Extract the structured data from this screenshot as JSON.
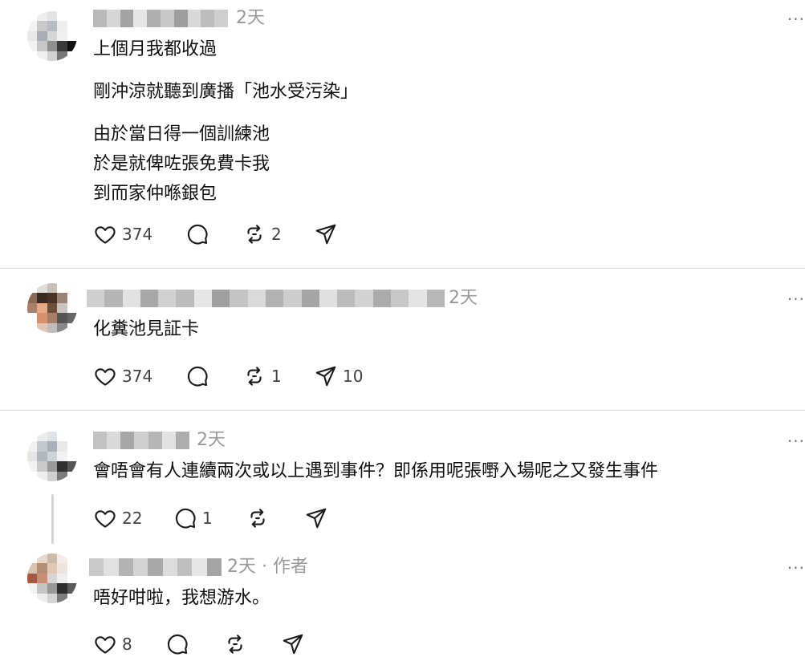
{
  "posts": [
    {
      "time": "2天",
      "lines": [
        "上個月我都收過",
        "剛沖涼就聽到廣播「池水受污染」",
        "由於當日得一個訓練池",
        "於是就俾咗張免費卡我",
        "到而家仲喺銀包"
      ],
      "likes": "374",
      "replies": "",
      "reposts": "2",
      "shares": ""
    },
    {
      "time": "2天",
      "lines": [
        "化糞池見証卡"
      ],
      "likes": "374",
      "replies": "",
      "reposts": "1",
      "shares": "10"
    },
    {
      "time": "2天",
      "lines": [
        "會唔會有人連續兩次或以上遇到事件？即係用呢張嘢入場呢之又發生事件"
      ],
      "likes": "22",
      "replies": "1",
      "reposts": "",
      "shares": ""
    },
    {
      "time": "2天 · 作者",
      "lines": [
        "唔好咁啦，我想游水。"
      ],
      "likes": "8",
      "replies": "",
      "reposts": "",
      "shares": ""
    }
  ],
  "icons": {
    "like": "heart-icon",
    "reply": "comment-icon",
    "repost": "repost-icon",
    "share": "send-icon",
    "more": "more-dots-icon"
  },
  "colors": {
    "text": "#101010",
    "muted": "#999999",
    "icon": "#1a1a1a",
    "divider": "#d9d9d9"
  },
  "more_label": "···"
}
